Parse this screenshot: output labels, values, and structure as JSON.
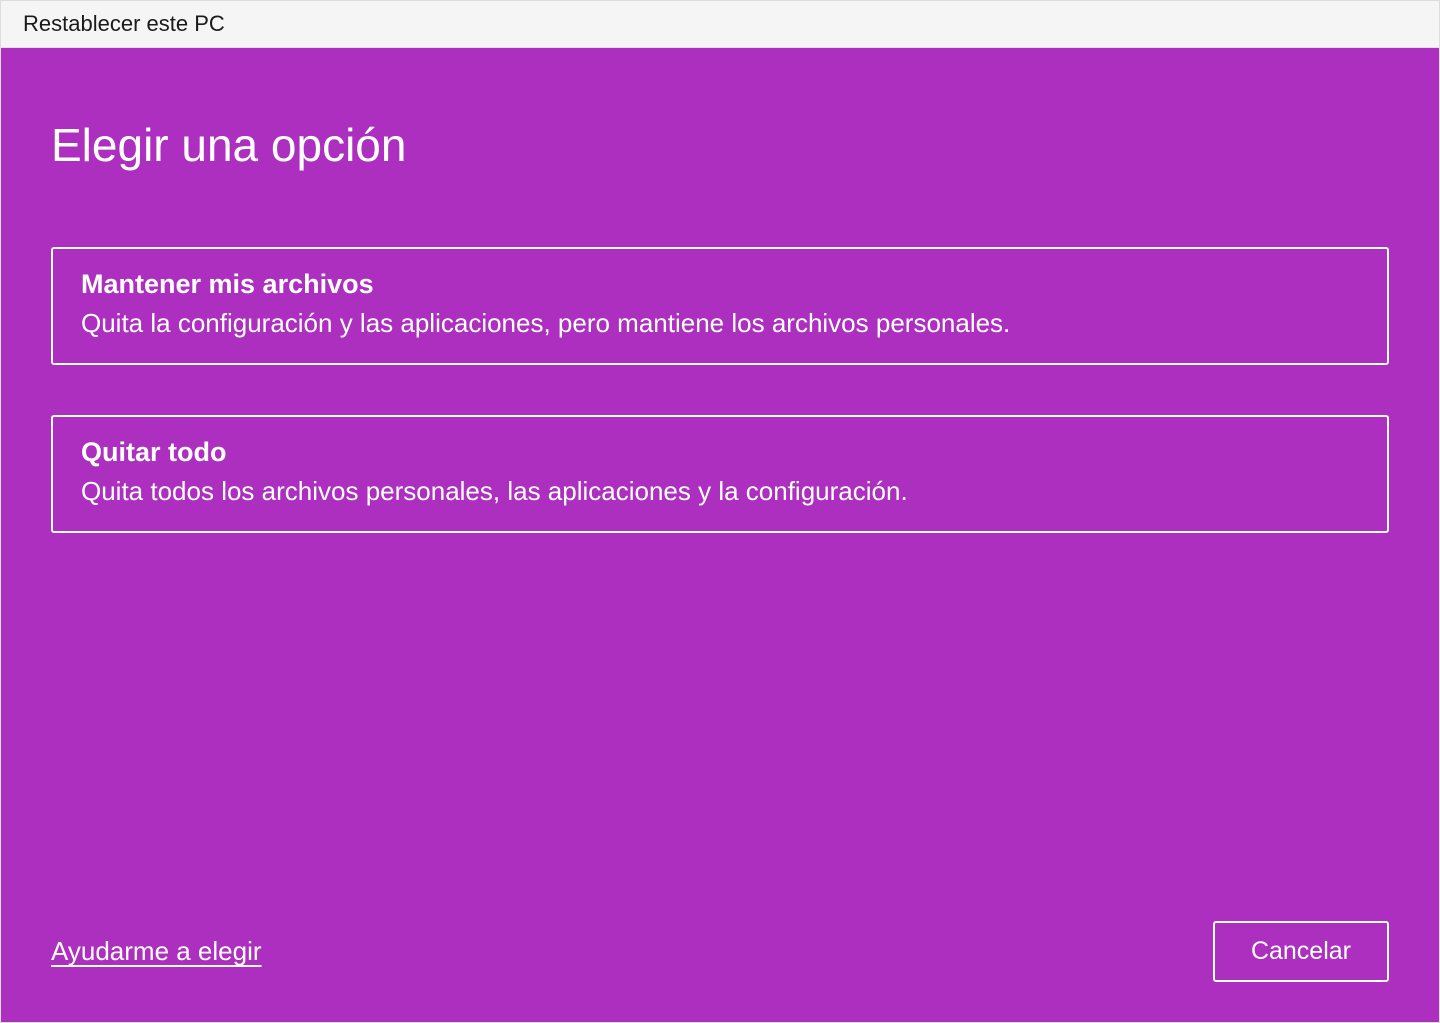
{
  "titleBar": {
    "title": "Restablecer este PC"
  },
  "heading": "Elegir una opción",
  "options": [
    {
      "title": "Mantener mis archivos",
      "description": "Quita la configuración y las aplicaciones, pero mantiene los archivos personales."
    },
    {
      "title": "Quitar todo",
      "description": "Quita todos los archivos personales, las aplicaciones y la configuración."
    }
  ],
  "footer": {
    "helpLink": "Ayudarme a elegir",
    "cancelButton": "Cancelar"
  },
  "colors": {
    "accent": "#ad2fbf",
    "titleBarBg": "#f5f5f5",
    "text": "#ffffff"
  }
}
